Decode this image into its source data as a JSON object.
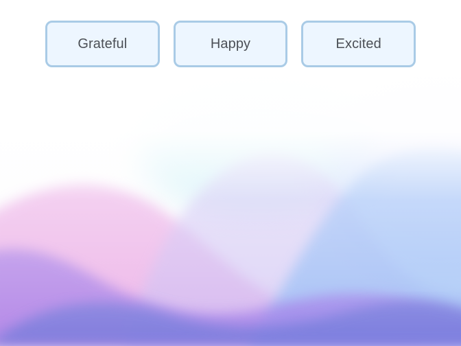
{
  "mood_options": [
    {
      "label": "Grateful"
    },
    {
      "label": "Happy"
    },
    {
      "label": "Excited"
    }
  ],
  "theme": {
    "chip_background": "#edf6ff",
    "chip_border": "#a9cbe6",
    "chip_text": "#4b4f55",
    "pink": "#e9a2e3",
    "purple": "#a77ee8",
    "blue": "#7fb6f0",
    "aqua": "#a9e7f3"
  }
}
